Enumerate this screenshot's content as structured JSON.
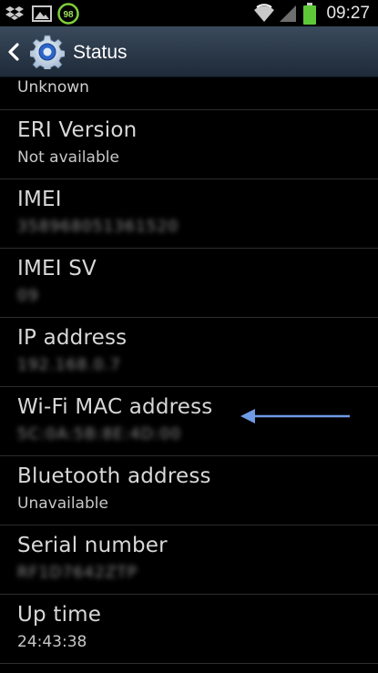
{
  "status_bar": {
    "time": "09:27",
    "notification_badge": "98",
    "icons": [
      "dropbox-icon",
      "gallery-icon",
      "notification-badge-icon",
      "wifi-icon",
      "signal-icon",
      "battery-icon"
    ],
    "battery_color": "#5ec838"
  },
  "action_bar": {
    "title": "Status",
    "back_icon": "chevron-left-icon",
    "app_icon": "settings-gear-icon"
  },
  "list": {
    "partial_item": {
      "sub": "Unknown"
    },
    "items": [
      {
        "label": "ERI Version",
        "sub": "Not available",
        "blurred": false
      },
      {
        "label": "IMEI",
        "sub": "358968051361520",
        "blurred": true
      },
      {
        "label": "IMEI SV",
        "sub": "09",
        "blurred": true
      },
      {
        "label": "IP address",
        "sub": "192.168.0.7",
        "blurred": true
      },
      {
        "label": "Wi-Fi MAC address",
        "sub": "5C:0A:5B:8E:4D:00",
        "blurred": true
      },
      {
        "label": "Bluetooth address",
        "sub": "Unavailable",
        "blurred": false
      },
      {
        "label": "Serial number",
        "sub": "RF1D7642ZTP",
        "blurred": true
      },
      {
        "label": "Up time",
        "sub": "24:43:38",
        "blurred": false
      }
    ]
  },
  "annotation": {
    "arrow_color": "#6f9be6",
    "points_to": "Wi-Fi MAC address"
  }
}
